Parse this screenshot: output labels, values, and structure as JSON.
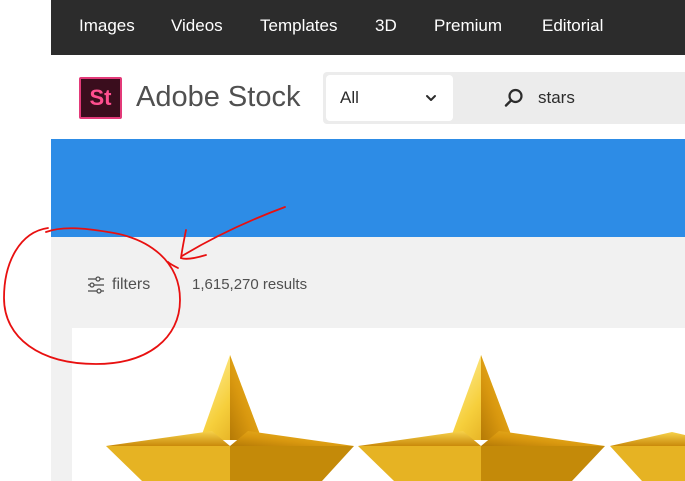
{
  "topnav": {
    "items": [
      {
        "label": "Images"
      },
      {
        "label": "Videos"
      },
      {
        "label": "Templates"
      },
      {
        "label": "3D"
      },
      {
        "label": "Premium"
      },
      {
        "label": "Editorial"
      }
    ]
  },
  "header": {
    "logo_text": "St",
    "brand": "Adobe Stock",
    "search": {
      "category_value": "All",
      "query": "stars",
      "icon": "search-icon"
    }
  },
  "toolbar": {
    "filters_label": "filters",
    "filters_icon": "sliders-icon",
    "results_count": "1,615,270 results"
  },
  "colors": {
    "nav_background": "#2c2c2c",
    "banner": "#2d8ce6",
    "brand_accent": "#e33a79",
    "annotation": "#e81010"
  }
}
